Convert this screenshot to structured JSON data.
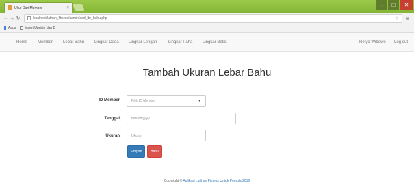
{
  "browser": {
    "tab_title": "Ukur Dari Member",
    "tab_close": "×",
    "url": "localhost/lathan_fitness/admin/add_lbr_bahu.php",
    "bookmarks": [
      "Apps",
      "Insert Update dan D"
    ]
  },
  "navbar": {
    "items": [
      "Home",
      "Member",
      "Lebar Bahu",
      "Lingkar Dada",
      "Lingkar Lengan",
      "Lingkar Paha",
      "Lingkar Betis"
    ],
    "user": "Retyo Wibowo",
    "logout": "Log out"
  },
  "page": {
    "title": "Tambah Ukuran Lebar Bahu"
  },
  "form": {
    "member_label": "ID Member",
    "member_placeholder": "Pilih ID Member",
    "date_label": "Tanggal",
    "date_placeholder": "mm/dd/yyyy",
    "size_label": "Ukuran",
    "size_placeholder": "Ukuran",
    "save_button": "Simpan",
    "cancel_button": "Batal"
  },
  "footer": {
    "prefix": "Copyright © ",
    "brand": "Aplikasi Latihan Fitness Untuk Pemula 2016"
  },
  "colors": {
    "chrome": "#8fbf3f",
    "primary": "#337ab7",
    "danger": "#d9534f"
  }
}
